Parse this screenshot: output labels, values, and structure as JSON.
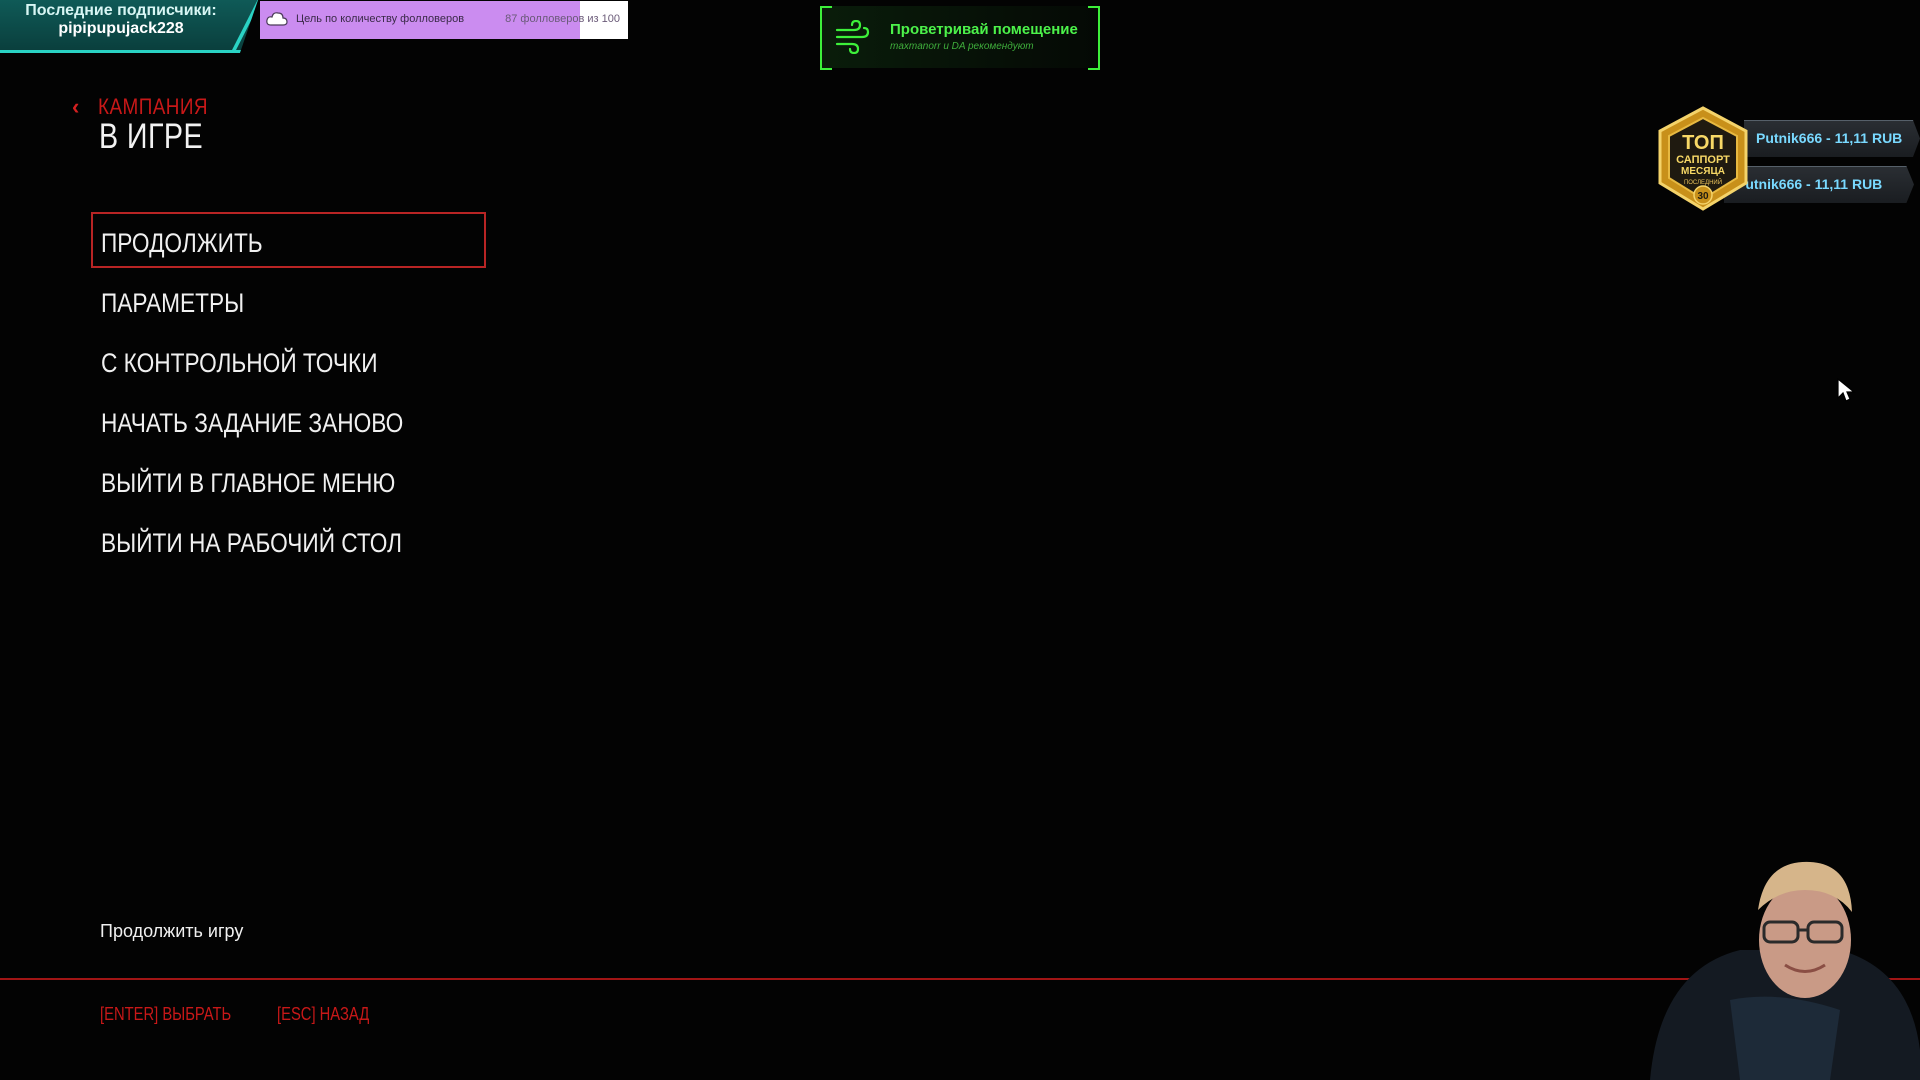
{
  "overlay": {
    "followers": {
      "title": "Последние подписчики:",
      "name": "pipipupujack228"
    },
    "goal": {
      "label": "Цель по количеству фолловеров",
      "count": "87 фолловеров из 100",
      "progress": 0.87,
      "color": "#cb8cf0"
    },
    "vent": {
      "title": "Проветривай помещение",
      "subtitle": "maxmanorr и DA рекомендуют",
      "icon": "wind-icon",
      "color": "#3df03a"
    },
    "donation": {
      "badge_top": "ТОП",
      "badge_mid": "САППОРТ",
      "badge_sub": "МЕСЯЦА",
      "badge_small": "ПОСЛЕДНИЙ",
      "badge_number": "30",
      "entries": [
        {
          "text": "Putnik666 - 11,11 RUB"
        },
        {
          "text": "Putnik666 - 11,11 RUB"
        }
      ]
    }
  },
  "game": {
    "back_label": "КАМПАНИЯ",
    "title": "В ИГРЕ",
    "accent_color": "#c81818",
    "menu": [
      {
        "label": "ПРОДОЛЖИТЬ",
        "selected": true
      },
      {
        "label": "ПАРАМЕТРЫ",
        "selected": false
      },
      {
        "label": "С КОНТРОЛЬНОЙ ТОЧКИ",
        "selected": false
      },
      {
        "label": "НАЧАТЬ ЗАДАНИЕ ЗАНОВО",
        "selected": false
      },
      {
        "label": "ВЫЙТИ В ГЛАВНОЕ МЕНЮ",
        "selected": false
      },
      {
        "label": "ВЫЙТИ НА РАБОЧИЙ СТОЛ",
        "selected": false
      }
    ],
    "hint": "Продолжить игру",
    "footer": {
      "select": "[ENTER] ВЫБРАТЬ",
      "back": "[ESC] НАЗАД"
    }
  }
}
